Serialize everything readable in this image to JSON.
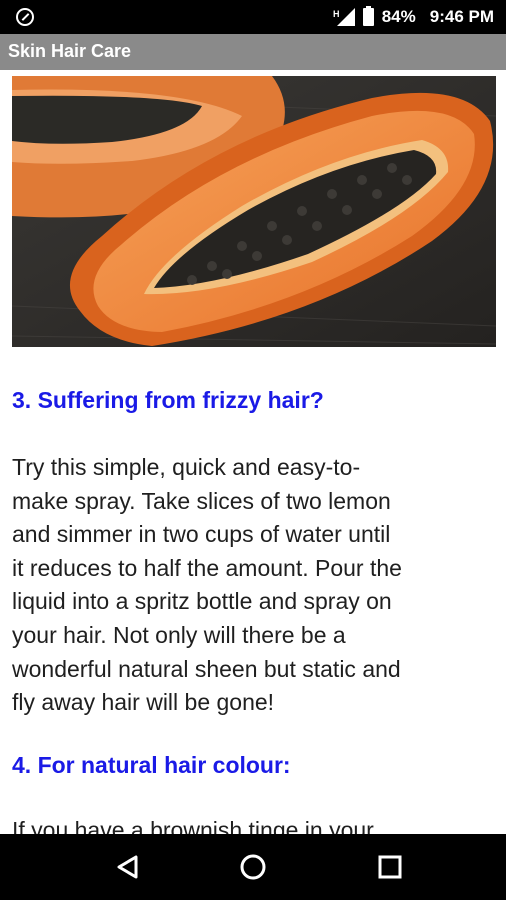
{
  "status_bar": {
    "battery": "84%",
    "time": "9:46 PM",
    "network": "H"
  },
  "app": {
    "title": "Skin Hair Care"
  },
  "article": {
    "hero_image": "papaya-halves",
    "section3": {
      "heading": "3. Suffering from frizzy hair?",
      "lines": [
        "Try this simple, quick and easy-to-",
        "make spray. Take slices of two lemon",
        "and simmer in two cups of water until",
        "it reduces to half the amount. Pour the",
        "liquid into a spritz bottle and spray on",
        "your hair. Not only will there be a",
        "wonderful natural sheen but static and",
        "fly away hair will be gone!"
      ]
    },
    "section4": {
      "heading": "4. For natural hair colour:",
      "first_line": "If you have a brownish tinge in your"
    }
  },
  "nav": {
    "back": "back-icon",
    "home": "home-icon",
    "recents": "recents-icon"
  },
  "colors": {
    "heading": "#1a1ae6",
    "appbar": "#8a8a8a"
  }
}
